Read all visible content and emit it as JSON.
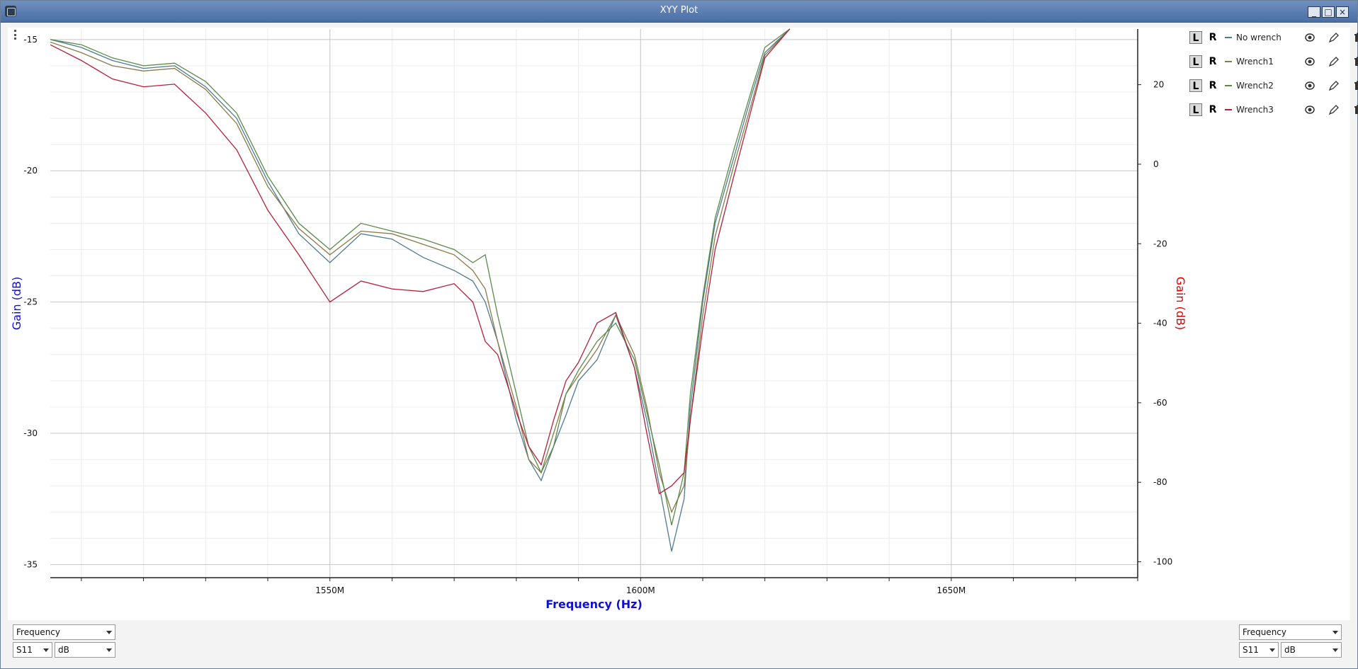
{
  "window": {
    "title": "XYY Plot"
  },
  "chart_data": {
    "type": "line",
    "xlabel": "Frequency (Hz)",
    "ylabel_left": "Gain (dB)",
    "ylabel_right": "Gain (dB)",
    "x_ticks": [
      "1550M",
      "1600M",
      "1650M"
    ],
    "y_left_ticks": [
      "-15",
      "-20",
      "-25",
      "-30",
      "-35"
    ],
    "y_right_ticks": [
      "20",
      "0",
      "-20",
      "-40",
      "-60",
      "-80",
      "-100"
    ],
    "xlim": [
      1505,
      1680
    ],
    "ylim_left": [
      -35.5,
      -14.6
    ],
    "ylim_right": [
      -104,
      34
    ],
    "grid": true,
    "legend_position": "top-right",
    "series": [
      {
        "name": "No wrench",
        "axis": "left",
        "color": "#4f7b8f",
        "x": [
          1505,
          1510,
          1515,
          1520,
          1525,
          1530,
          1535,
          1540,
          1545,
          1550,
          1555,
          1560,
          1565,
          1570,
          1573,
          1575,
          1577,
          1580,
          1582,
          1584,
          1586,
          1588,
          1590,
          1593,
          1596,
          1599,
          1601,
          1603,
          1605,
          1607,
          1608,
          1610,
          1612,
          1615,
          1618,
          1620,
          1624
        ],
        "y": [
          -15.0,
          -15.3,
          -15.8,
          -16.1,
          -16.0,
          -16.8,
          -18.0,
          -20.4,
          -22.4,
          -23.5,
          -22.4,
          -22.6,
          -23.3,
          -23.8,
          -24.2,
          -25.0,
          -26.5,
          -29.5,
          -31.0,
          -31.8,
          -30.5,
          -29.3,
          -28.0,
          -27.2,
          -25.5,
          -27.5,
          -29.5,
          -32.0,
          -34.5,
          -32.5,
          -29.0,
          -25.0,
          -22.0,
          -19.5,
          -17.0,
          -15.5,
          -14.6
        ]
      },
      {
        "name": "Wrench1",
        "axis": "left",
        "color": "#8a7a4a",
        "x": [
          1505,
          1510,
          1515,
          1520,
          1525,
          1530,
          1535,
          1540,
          1545,
          1550,
          1555,
          1560,
          1565,
          1570,
          1573,
          1575,
          1577,
          1580,
          1582,
          1584,
          1586,
          1588,
          1590,
          1593,
          1596,
          1599,
          1601,
          1603,
          1605,
          1607,
          1608,
          1610,
          1612,
          1615,
          1618,
          1620,
          1624
        ],
        "y": [
          -15.1,
          -15.5,
          -16.0,
          -16.2,
          -16.1,
          -16.9,
          -18.2,
          -20.6,
          -22.2,
          -23.2,
          -22.3,
          -22.4,
          -22.8,
          -23.2,
          -23.8,
          -24.5,
          -26.5,
          -29.0,
          -31.0,
          -31.5,
          -30.0,
          -28.5,
          -27.8,
          -26.8,
          -25.5,
          -27.0,
          -29.0,
          -31.5,
          -33.0,
          -32.0,
          -29.5,
          -25.5,
          -22.5,
          -19.8,
          -17.3,
          -15.6,
          -14.6
        ]
      },
      {
        "name": "Wrench2",
        "axis": "left",
        "color": "#5a8a4a",
        "x": [
          1505,
          1510,
          1515,
          1520,
          1525,
          1530,
          1535,
          1540,
          1545,
          1550,
          1555,
          1560,
          1565,
          1570,
          1573,
          1575,
          1577,
          1580,
          1582,
          1584,
          1586,
          1588,
          1590,
          1593,
          1596,
          1599,
          1601,
          1603,
          1605,
          1607,
          1608,
          1610,
          1612,
          1615,
          1618,
          1620,
          1624
        ],
        "y": [
          -15.0,
          -15.2,
          -15.7,
          -16.0,
          -15.9,
          -16.6,
          -17.8,
          -20.2,
          -22.0,
          -23.0,
          -22.0,
          -22.3,
          -22.6,
          -23.0,
          -23.5,
          -23.2,
          -25.5,
          -28.5,
          -30.5,
          -31.5,
          -30.5,
          -28.5,
          -27.6,
          -26.5,
          -25.8,
          -27.2,
          -29.2,
          -31.2,
          -33.5,
          -31.5,
          -28.5,
          -24.8,
          -21.8,
          -19.2,
          -16.8,
          -15.3,
          -14.6
        ]
      },
      {
        "name": "Wrench3",
        "axis": "left",
        "color": "#b4203a",
        "x": [
          1505,
          1510,
          1515,
          1520,
          1525,
          1530,
          1535,
          1540,
          1545,
          1550,
          1555,
          1560,
          1565,
          1570,
          1573,
          1575,
          1577,
          1580,
          1582,
          1584,
          1586,
          1588,
          1590,
          1593,
          1596,
          1599,
          1601,
          1603,
          1605,
          1607,
          1608,
          1610,
          1612,
          1615,
          1618,
          1620,
          1624
        ],
        "y": [
          -15.2,
          -15.8,
          -16.5,
          -16.8,
          -16.7,
          -17.8,
          -19.2,
          -21.5,
          -23.2,
          -25.0,
          -24.2,
          -24.5,
          -24.6,
          -24.3,
          -25.0,
          -26.5,
          -27.0,
          -29.2,
          -30.5,
          -31.2,
          -29.5,
          -28.0,
          -27.3,
          -25.8,
          -25.4,
          -27.5,
          -30.0,
          -32.3,
          -32.0,
          -31.5,
          -29.5,
          -26.0,
          -23.0,
          -20.2,
          -17.5,
          -15.7,
          -14.6
        ]
      }
    ]
  },
  "legend": {
    "left_label": "L",
    "right_label": "R",
    "items": [
      {
        "name": "No wrench",
        "color": "#4f7b8f"
      },
      {
        "name": "Wrench1",
        "color": "#8a7a4a"
      },
      {
        "name": "Wrench2",
        "color": "#5a8a4a"
      },
      {
        "name": "Wrench3",
        "color": "#b4203a"
      }
    ]
  },
  "controls": {
    "left": {
      "x_axis": "Frequency",
      "param": "S11",
      "unit": "dB"
    },
    "right": {
      "x_axis": "Frequency",
      "param": "S11",
      "unit": "dB"
    }
  },
  "colors": {
    "left_axis": "#1010d0",
    "right_axis": "#e00000",
    "grid_major": "#c8c8c8",
    "grid_minor": "#ececec"
  }
}
